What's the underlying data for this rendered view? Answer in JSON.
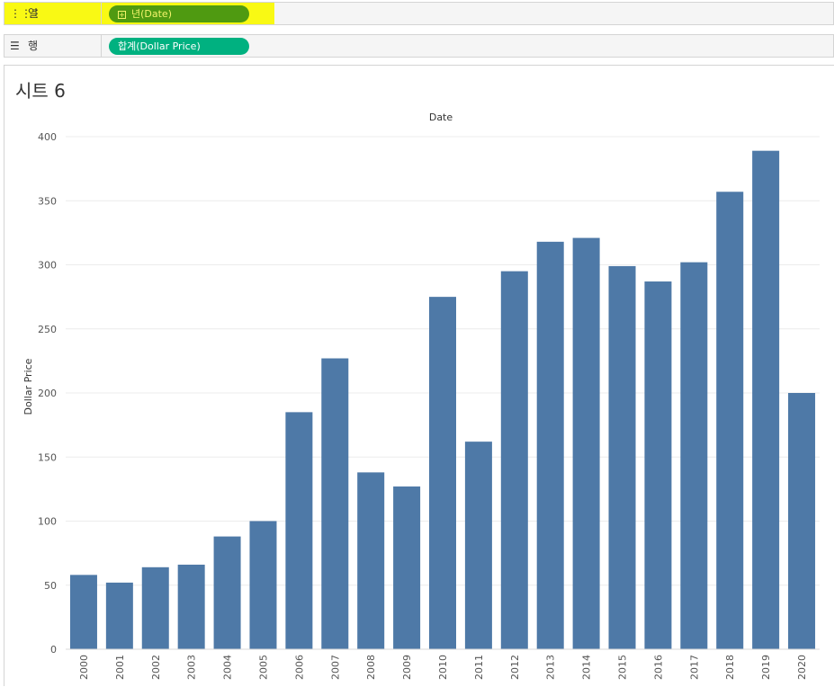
{
  "shelves": {
    "columns": {
      "icon": "columns-shelf-icon",
      "label": "열",
      "pill": "년(Date)",
      "pill_icon": "expand-plus-icon"
    },
    "rows": {
      "icon": "rows-shelf-icon",
      "label": "행",
      "pill": "합계(Dollar Price)"
    }
  },
  "sheet": {
    "title": "시트 6"
  },
  "colors": {
    "bar": "#4e79a7",
    "highlight": "#f8f800",
    "dim_pill": "#4f9a11",
    "measure_pill": "#00b180"
  },
  "chart_data": {
    "type": "bar",
    "title": "Date",
    "xlabel": "",
    "ylabel": "Dollar Price",
    "categories": [
      "2000",
      "2001",
      "2002",
      "2003",
      "2004",
      "2005",
      "2006",
      "2007",
      "2008",
      "2009",
      "2010",
      "2011",
      "2012",
      "2013",
      "2014",
      "2015",
      "2016",
      "2017",
      "2018",
      "2019",
      "2020"
    ],
    "values": [
      58,
      52,
      64,
      66,
      88,
      100,
      185,
      227,
      138,
      127,
      275,
      162,
      295,
      318,
      321,
      299,
      287,
      302,
      357,
      389,
      200
    ],
    "yticks": [
      0,
      50,
      100,
      150,
      200,
      250,
      300,
      350,
      400
    ],
    "ylim": [
      0,
      400
    ],
    "grid": true
  }
}
